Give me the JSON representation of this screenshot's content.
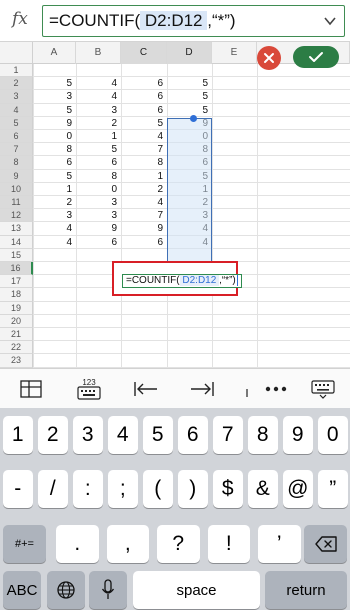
{
  "formula_bar": {
    "fx_label": "fx",
    "formula_prefix": "=COUNTIF(",
    "formula_range": " D2:D12 ",
    "formula_suffix": ",“*”)"
  },
  "columns": [
    "A",
    "B",
    "C",
    "D",
    "E"
  ],
  "rows": [
    "1",
    "2",
    "3",
    "4",
    "5",
    "6",
    "7",
    "8",
    "9",
    "10",
    "11",
    "12",
    "13",
    "14",
    "15",
    "16",
    "17",
    "18",
    "19",
    "20",
    "21",
    "22",
    "23"
  ],
  "data_rows": [
    {
      "row": "2",
      "A": "5",
      "B": "4",
      "C": "6",
      "D": "5"
    },
    {
      "row": "3",
      "A": "3",
      "B": "4",
      "C": "6",
      "D": "5"
    },
    {
      "row": "4",
      "A": "5",
      "B": "3",
      "C": "6",
      "D": "5"
    },
    {
      "row": "5",
      "A": "9",
      "B": "2",
      "C": "5",
      "D": "9"
    },
    {
      "row": "6",
      "A": "0",
      "B": "1",
      "C": "4",
      "D": "0"
    },
    {
      "row": "7",
      "A": "8",
      "B": "5",
      "C": "7",
      "D": "8"
    },
    {
      "row": "8",
      "A": "6",
      "B": "6",
      "C": "8",
      "D": "6"
    },
    {
      "row": "9",
      "A": "5",
      "B": "8",
      "C": "1",
      "D": "5"
    },
    {
      "row": "10",
      "A": "1",
      "B": "0",
      "C": "2",
      "D": "1"
    },
    {
      "row": "11",
      "A": "2",
      "B": "3",
      "C": "4",
      "D": "2"
    },
    {
      "row": "12",
      "A": "3",
      "B": "3",
      "C": "7",
      "D": "3"
    },
    {
      "row": "13",
      "A": "4",
      "B": "9",
      "C": "9",
      "D": "4"
    },
    {
      "row": "14",
      "A": "4",
      "B": "6",
      "C": "6",
      "D": "4"
    }
  ],
  "cell_editor": {
    "prefix": "=COUNTIF(",
    "range": " D2:D12 ",
    "suffix": ",“*”)"
  },
  "actions": {
    "cancel_icon": "close-icon",
    "confirm_icon": "checkmark-icon",
    "cancel_color": "#d9493a",
    "confirm_color": "#2c7d45"
  },
  "toolbar": {
    "items": [
      "table-icon",
      "numeric-keypad-icon",
      "tab-left-icon",
      "tab-right-icon",
      "more-icon",
      "keyboard-icon"
    ],
    "keypad_badge": "123"
  },
  "keyboard": {
    "row1": [
      "1",
      "2",
      "3",
      "4",
      "5",
      "6",
      "7",
      "8",
      "9",
      "0"
    ],
    "row2": [
      "-",
      "/",
      ":",
      ";",
      "(",
      ")",
      "$",
      "&",
      "@",
      "”"
    ],
    "row3_left": "#+=",
    "row3": [
      ".",
      ",",
      "?",
      "!",
      "’"
    ],
    "abc": "ABC",
    "space": "space",
    "return": "return"
  },
  "colors": {
    "accent_green": "#2c7d45",
    "range_blue": "#2f6fd6",
    "highlight_red": "#d81f26"
  }
}
